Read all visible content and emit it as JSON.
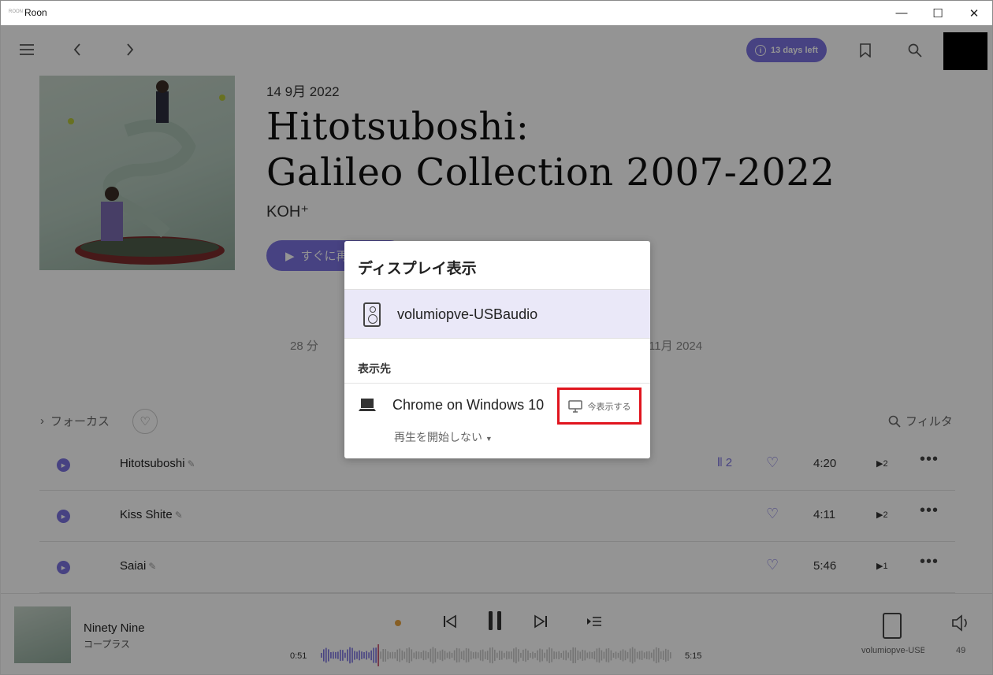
{
  "window": {
    "title": "Roon",
    "app_icon_text": "ROON"
  },
  "topbar": {
    "trial_badge": "13 days left",
    "trial_icon": "i"
  },
  "album": {
    "release_date": "14 9月 2022",
    "title_line1": "Hitotsuboshi:",
    "title_line2": "Galileo Collection 2007-2022",
    "artist": "KOH⁺",
    "play_button": "すぐに再",
    "duration": "28 分",
    "added_date": "11月 2024"
  },
  "tracklist": {
    "focus_label": "フォーカス",
    "filter_label": "フィルタ",
    "tracks": [
      {
        "title": "Hitotsuboshi",
        "versions": "2",
        "duration": "4:20",
        "plays": "2"
      },
      {
        "title": "Kiss Shite",
        "versions": "",
        "duration": "4:11",
        "plays": "2"
      },
      {
        "title": "Saiai",
        "versions": "",
        "duration": "5:46",
        "plays": "1"
      }
    ]
  },
  "now_playing": {
    "title": "Ninety Nine",
    "artist": "コープラス",
    "elapsed": "0:51",
    "total": "5:15",
    "zone_name": "volumiopve-USBaudio",
    "volume": "49",
    "progress": 0.162
  },
  "modal": {
    "title": "ディスプレイ表示",
    "zone_name": "volumiopve-USBaudio",
    "destination_label": "表示先",
    "destination_name": "Chrome on Windows 10",
    "show_now_label": "今表示する",
    "option_label": "再生を開始しない"
  },
  "colors": {
    "accent": "#7b72e0",
    "highlight": "#e0141e",
    "dot": "#e8a440"
  }
}
